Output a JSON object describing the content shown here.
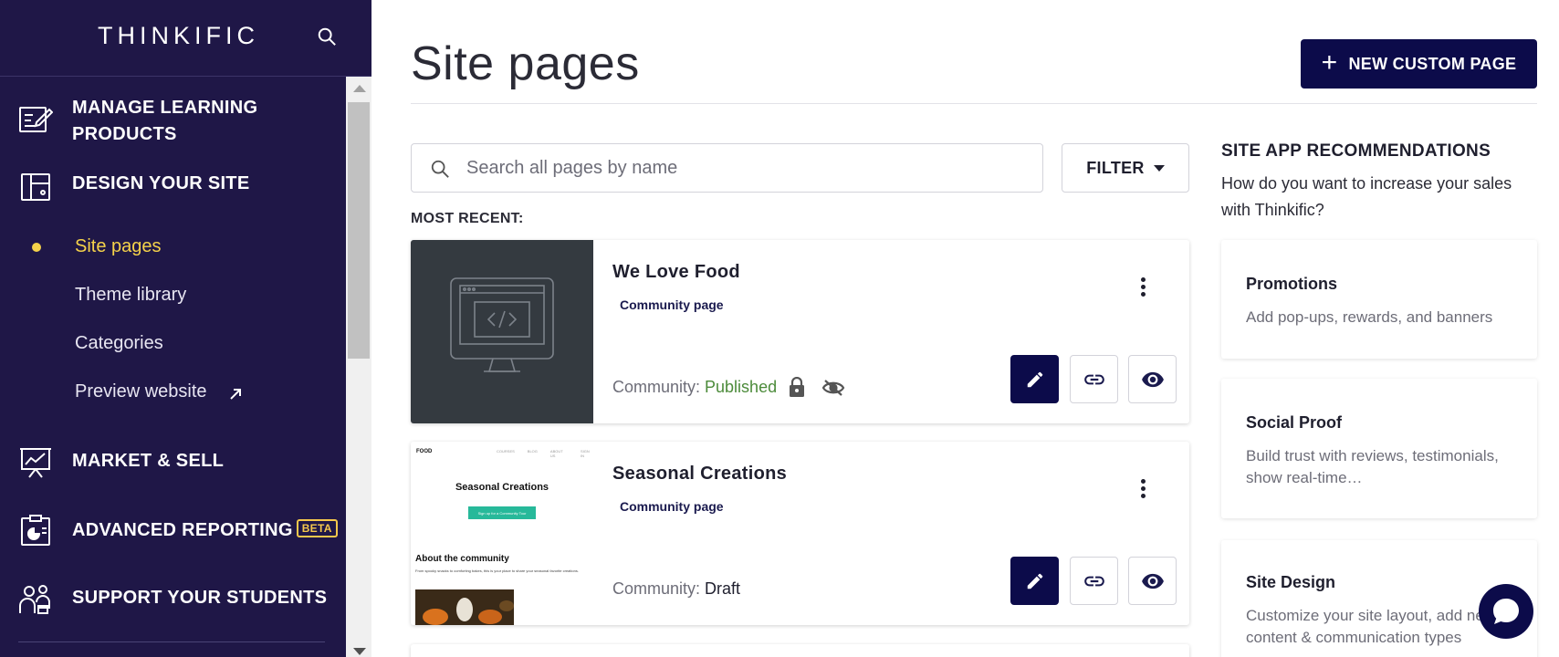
{
  "sidebar": {
    "logo": "THINKIFIC",
    "nav": [
      {
        "label": "MANAGE LEARNING PRODUCTS",
        "icon": "manage-learning-icon"
      },
      {
        "label": "DESIGN YOUR SITE",
        "icon": "design-site-icon"
      },
      {
        "label": "MARKET & SELL",
        "icon": "market-sell-icon"
      },
      {
        "label": "ADVANCED REPORTING",
        "badge": "BETA",
        "icon": "reporting-icon"
      },
      {
        "label": "SUPPORT YOUR STUDENTS",
        "icon": "support-students-icon"
      }
    ],
    "sub_items": [
      {
        "label": "Site pages",
        "active": true
      },
      {
        "label": "Theme library"
      },
      {
        "label": "Categories"
      },
      {
        "label": "Preview website",
        "icon": "external-link-icon"
      }
    ]
  },
  "main": {
    "title": "Site pages",
    "new_button": "NEW CUSTOM PAGE",
    "search_placeholder": "Search all pages by name",
    "filter_label": "FILTER",
    "most_recent_label": "MOST RECENT:",
    "pages": [
      {
        "title": "We Love Food",
        "type": "Community page",
        "status_label": "Community: ",
        "status": "Published",
        "status_color": "#4c8b3a"
      },
      {
        "title": "Seasonal Creations",
        "type": "Community page",
        "status_label": "Community: ",
        "status": "Draft"
      }
    ],
    "thumb2": {
      "brand": "FOOD",
      "nav": [
        "COURSES",
        "BLOG",
        "ABOUT US",
        "SIGN IN"
      ],
      "heading": "Seasonal Creations",
      "cta": "Sign up for a Community Tour",
      "section": "About the community",
      "body": "From spooky snacks to comforting bakes, this is your place to share your seasonal favorite creations."
    }
  },
  "recommendations": {
    "title": "SITE APP RECOMMENDATIONS",
    "subtitle": "How do you want to increase your sales with Thinkific?",
    "cards": [
      {
        "name": "Promotions",
        "desc": "Add pop-ups, rewards, and banners"
      },
      {
        "name": "Social Proof",
        "desc": "Build trust with reviews, testimonials, show real-time…"
      },
      {
        "name": "Site Design",
        "desc": "Customize your site layout, add new content & communication types"
      }
    ]
  },
  "colors": {
    "sidebar_bg": "#1f1747",
    "accent": "#f5d24a",
    "primary": "#0c0b4a"
  }
}
